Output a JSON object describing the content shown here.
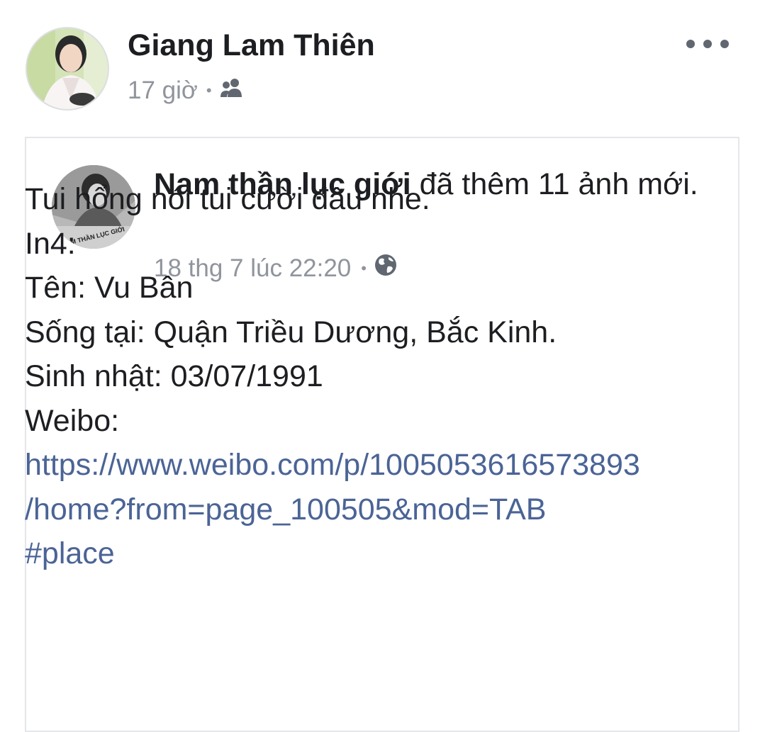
{
  "post": {
    "author_name": "Giang Lam Thiên",
    "time": "17 giờ",
    "separator": "•",
    "audience_icon": "friends-icon"
  },
  "shared": {
    "page_name": "Nam thần lục giới",
    "action_text": " đã thêm 11 ảnh mới.",
    "avatar_text": "NAM THẦN LỤC GIỚI",
    "time": "18 thg 7 lúc 22:20",
    "separator": "•",
    "audience_icon": "globe-icon"
  },
  "body": {
    "lines": [
      "Tui hổng nói tui cười đâu nhe.",
      "In4:",
      "Tên: Vu Bân",
      "Sống tại: Quận Triều Dương, Bắc Kinh.",
      "Sinh nhật: 03/07/1991",
      "Weibo:"
    ],
    "link_line_1": "https://www.weibo.com/p/1005053616573893",
    "link_line_2": "/home?from=page_100505&mod=TAB",
    "hashtag": "#place"
  },
  "colors": {
    "text": "#1c1e21",
    "meta": "#90949c",
    "link": "#4b6496",
    "card_border": "#e4e6eb"
  }
}
